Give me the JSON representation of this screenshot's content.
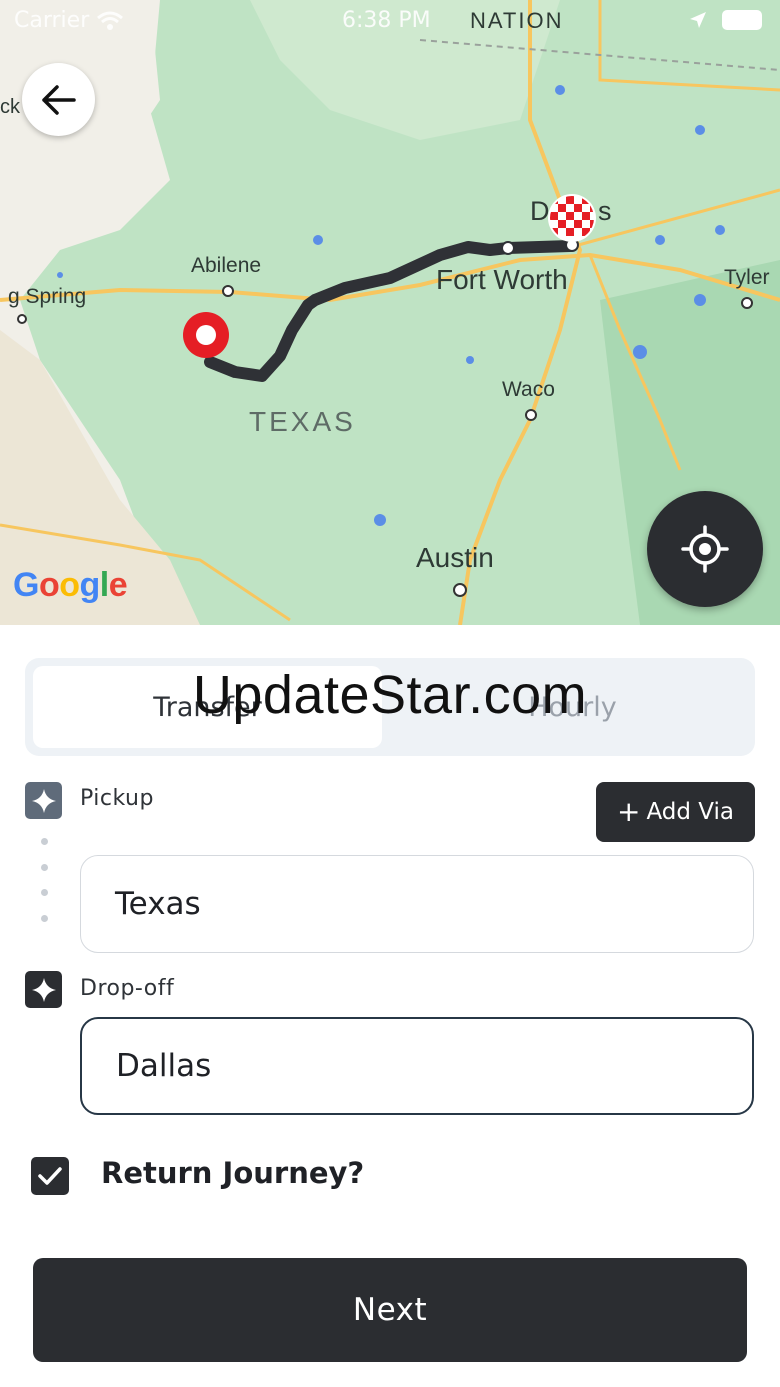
{
  "status_bar": {
    "carrier": "Carrier",
    "time": "6:38 PM"
  },
  "map": {
    "labels": {
      "nation": "NATION",
      "abilene": "Abilene",
      "big_spring": "g Spring",
      "texas": "TEXAS",
      "dallas_left": "D",
      "dallas_right": "s",
      "fort_worth": "Fort Worth",
      "tyler": "Tyler",
      "waco": "Waco",
      "austin": "Austin",
      "lubbock_partial": "ck"
    },
    "attribution": "Google",
    "colors": {
      "land": "#f1efe8",
      "park": "#bfe3c4",
      "water": "#5b8ee6",
      "route": "#2f3136",
      "road": "#f7c65f",
      "start_pin": "#e51e25"
    }
  },
  "watermark": "UpdateStar.com",
  "booking": {
    "tabs": [
      {
        "label": "Transfer",
        "active": true
      },
      {
        "label": "Hourly",
        "active": false
      }
    ],
    "pickup": {
      "label": "Pickup",
      "value": "Texas"
    },
    "add_via_label": "Add Via",
    "dropoff": {
      "label": "Drop-off",
      "value": "Dallas"
    },
    "return_journey": {
      "label": "Return Journey?",
      "checked": true
    },
    "next_label": "Next"
  }
}
